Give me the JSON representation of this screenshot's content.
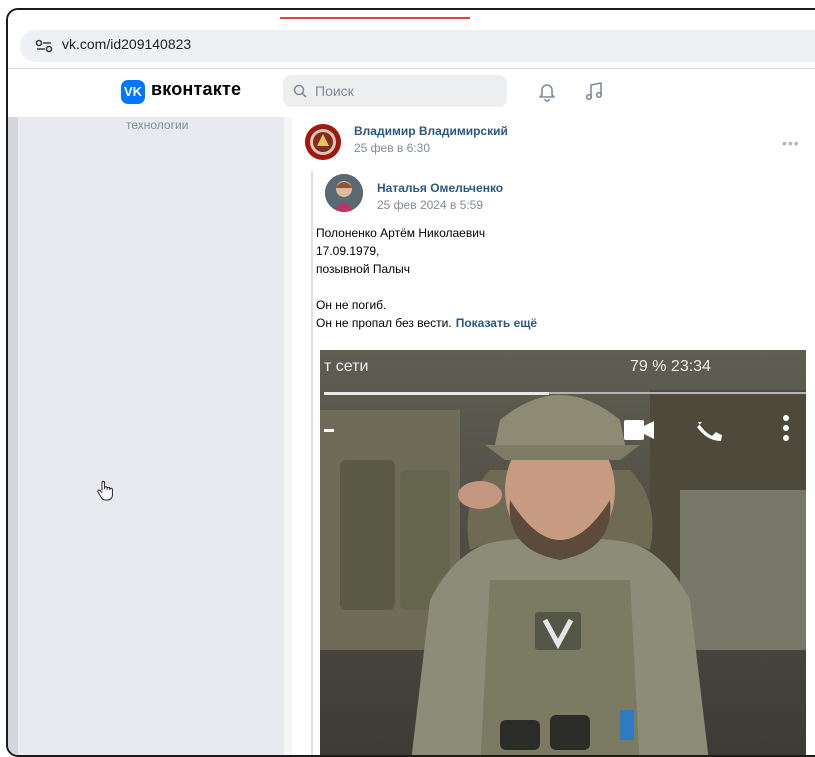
{
  "browser": {
    "url": "vk.com/id209140823"
  },
  "header": {
    "brand": "вконтакте",
    "logo_text": "VK",
    "search_placeholder": "Поиск",
    "icons": [
      "notifications-bell-icon",
      "music-note-icon"
    ]
  },
  "sidebar": {
    "partial_text": "технологии"
  },
  "post": {
    "author": "Владимир Владимирский",
    "date": "25 фев в 6:30",
    "more": "•••",
    "repost": {
      "author": "Наталья Омельченко",
      "date": "25 фев 2024 в 5:59",
      "lines": [
        "Полоненко Артём Николаевич",
        "17.09.1979,",
        "позывной Палыч",
        "",
        "Он не погиб.",
        "Он не пропал без вести."
      ],
      "show_more": "Показать ещё"
    },
    "photo": {
      "status_left": "т сети",
      "status_right": "79 %  23:34",
      "patch_letter": "V"
    }
  },
  "colors": {
    "vk_blue": "#0077ff",
    "link": "#2a5885",
    "muted": "#818c99",
    "tab_loading": "#e0443b"
  }
}
